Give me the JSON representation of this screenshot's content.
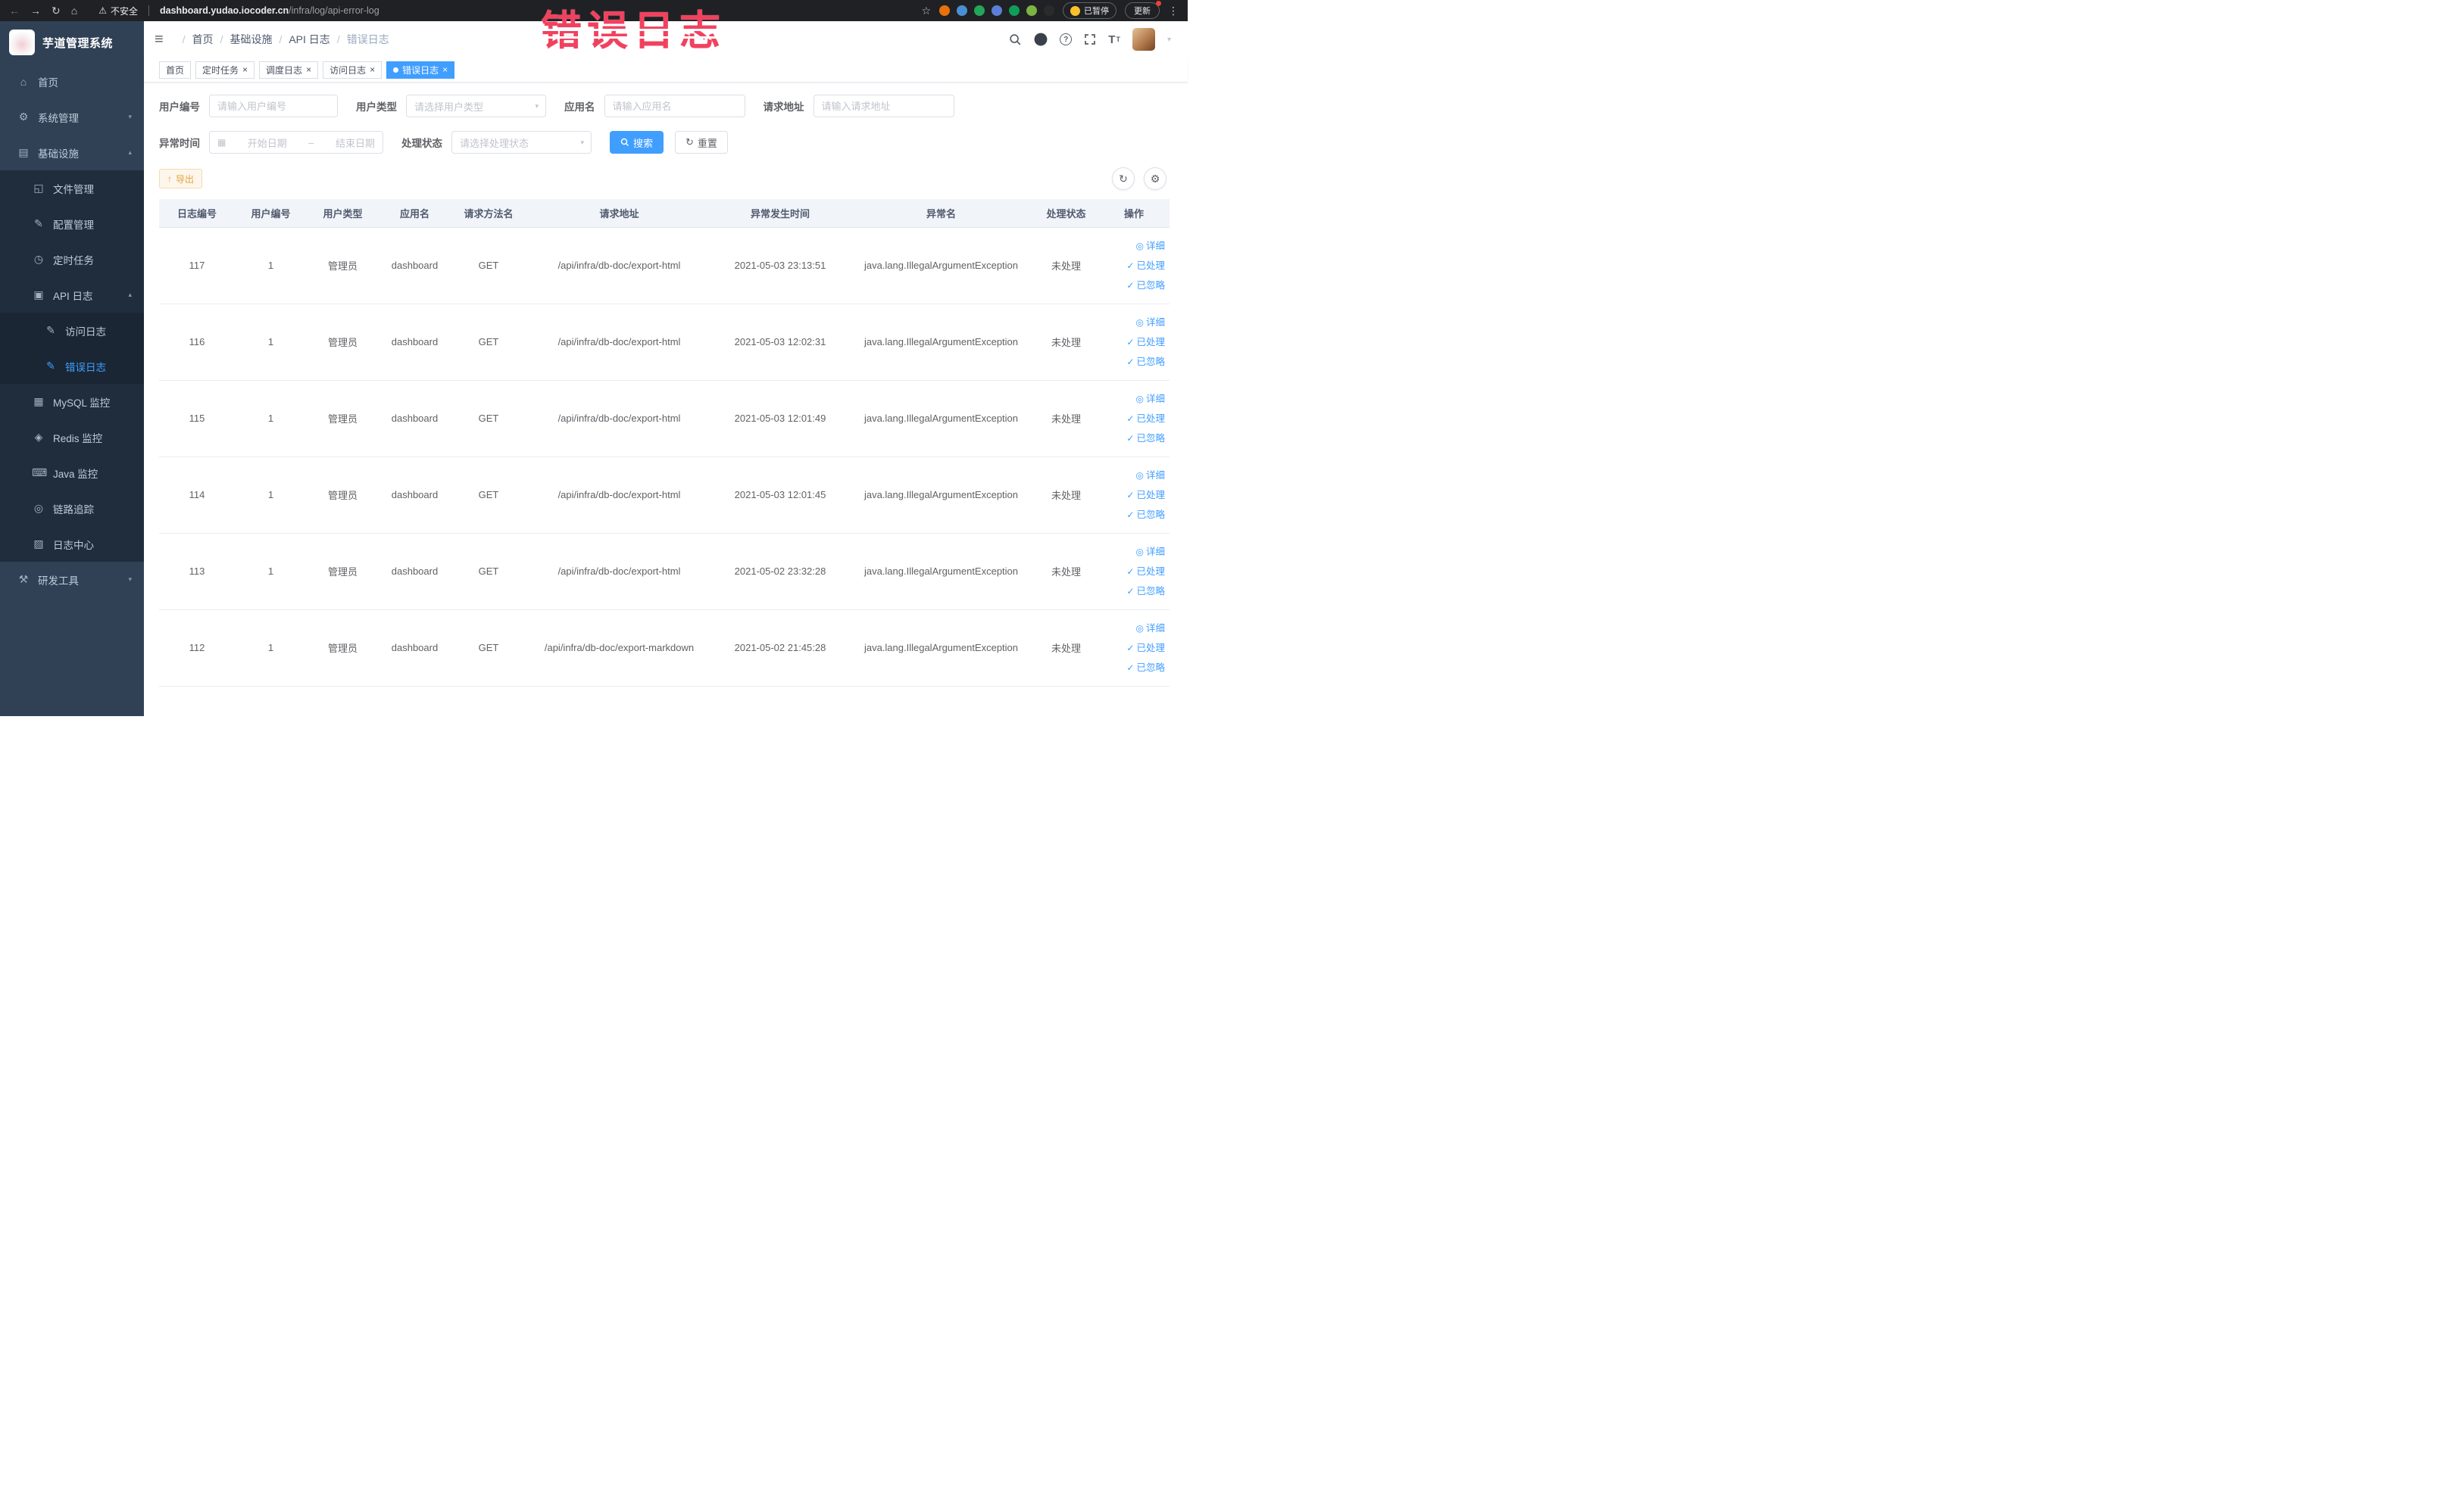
{
  "annotation": {
    "text": "错误日志"
  },
  "browser": {
    "security_warning": "不安全",
    "url_domain": "dashboard.yudao.iocoder.cn",
    "url_path": "/infra/log/api-error-log",
    "paused_badge": "已暂停",
    "update_button": "更新",
    "extensions": [
      {
        "name": "extension-red-circle-icon",
        "color": "#e8710a"
      },
      {
        "name": "extension-blue-drop-icon",
        "color": "#4a8fd4"
      },
      {
        "name": "extension-green-circle-icon",
        "color": "#23a55a"
      },
      {
        "name": "extension-blue-grid-icon",
        "color": "#5b7fd7"
      },
      {
        "name": "extension-on-badge-icon",
        "color": "#0f9d58"
      },
      {
        "name": "extension-leaf-icon",
        "color": "#7cb342"
      },
      {
        "name": "extension-paw-icon",
        "color": "#2b2b2b"
      }
    ]
  },
  "sidebar": {
    "app_title": "芋道管理系统",
    "menu": [
      {
        "name": "sidebar-item-home",
        "label": "首页",
        "icon": "home-icon",
        "level": 1
      },
      {
        "name": "sidebar-item-system",
        "label": "系统管理",
        "icon": "gear-icon",
        "level": 1,
        "arrow": "chevron-down-icon"
      },
      {
        "name": "sidebar-item-infra",
        "label": "基础设施",
        "icon": "infra-icon",
        "level": 1,
        "arrow": "chevron-up-icon",
        "open": true
      },
      {
        "name": "sidebar-item-file-manage",
        "label": "文件管理",
        "icon": "file-icon",
        "level": 2
      },
      {
        "name": "sidebar-item-config-manage",
        "label": "配置管理",
        "icon": "config-icon",
        "level": 2
      },
      {
        "name": "sidebar-item-scheduled-job",
        "label": "定时任务",
        "icon": "timer-icon",
        "level": 2
      },
      {
        "name": "sidebar-item-api-log",
        "label": "API 日志",
        "icon": "api-log-icon",
        "level": 2,
        "arrow": "chevron-up-icon",
        "open": true
      },
      {
        "name": "sidebar-item-access-log",
        "label": "访问日志",
        "icon": "access-log-icon",
        "level": 3
      },
      {
        "name": "sidebar-item-error-log",
        "label": "错误日志",
        "icon": "error-log-icon",
        "level": 3,
        "active": true
      },
      {
        "name": "sidebar-item-mysql-monitor",
        "label": "MySQL 监控",
        "icon": "mysql-icon",
        "level": 2
      },
      {
        "name": "sidebar-item-redis-monitor",
        "label": "Redis 监控",
        "icon": "redis-icon",
        "level": 2
      },
      {
        "name": "sidebar-item-java-monitor",
        "label": "Java 监控",
        "icon": "java-icon",
        "level": 2
      },
      {
        "name": "sidebar-item-trace",
        "label": "链路追踪",
        "icon": "trace-icon",
        "level": 2
      },
      {
        "name": "sidebar-item-log-center",
        "label": "日志中心",
        "icon": "log-center-icon",
        "level": 2
      },
      {
        "name": "sidebar-item-dev-tools",
        "label": "研发工具",
        "icon": "tools-icon",
        "level": 1,
        "arrow": "chevron-down-icon"
      }
    ]
  },
  "header": {
    "breadcrumb": [
      {
        "label": "首页",
        "clickable": "true"
      },
      {
        "label": "基础设施",
        "clickable": "false"
      },
      {
        "label": "API 日志",
        "clickable": "false"
      },
      {
        "label": "错误日志",
        "clickable": "false",
        "active": true
      }
    ],
    "icon_names": [
      "search-icon",
      "github-icon",
      "help-icon",
      "fullscreen-icon",
      "font-size-icon",
      "avatar",
      "chevron-down-icon"
    ]
  },
  "tabs": [
    {
      "name": "tab-home",
      "label": "首页"
    },
    {
      "name": "tab-scheduled-job",
      "label": "定时任务",
      "closable": true
    },
    {
      "name": "tab-job-log",
      "label": "调度日志",
      "closable": true
    },
    {
      "name": "tab-access-log",
      "label": "访问日志",
      "closable": true
    },
    {
      "name": "tab-error-log",
      "label": "错误日志",
      "closable": true,
      "active": true
    }
  ],
  "filters": {
    "user_id_label": "用户编号",
    "user_id_placeholder": "请输入用户编号",
    "user_type_label": "用户类型",
    "user_type_placeholder": "请选择用户类型",
    "app_name_label": "应用名",
    "app_name_placeholder": "请输入应用名",
    "request_url_label": "请求地址",
    "request_url_placeholder": "请输入请求地址",
    "exception_time_label": "异常时间",
    "start_date_placeholder": "开始日期",
    "date_separator": "–",
    "end_date_placeholder": "结束日期",
    "process_status_label": "处理状态",
    "process_status_placeholder": "请选择处理状态",
    "search_button": "搜索",
    "reset_button": "重置"
  },
  "toolbar": {
    "export_button": "导出"
  },
  "table": {
    "headers": [
      "日志编号",
      "用户编号",
      "用户类型",
      "应用名",
      "请求方法名",
      "请求地址",
      "异常发生时间",
      "异常名",
      "处理状态",
      "操作"
    ],
    "actions": [
      "详细",
      "已处理",
      "已忽略"
    ],
    "rows": [
      {
        "log_id": "117",
        "user_id": "1",
        "user_type": "管理员",
        "app_name": "dashboard",
        "method": "GET",
        "url": "/api/infra/db-doc/export-html",
        "time": "2021-05-03 23:13:51",
        "exception": "java.lang.IllegalArgumentException",
        "status": "未处理"
      },
      {
        "log_id": "116",
        "user_id": "1",
        "user_type": "管理员",
        "app_name": "dashboard",
        "method": "GET",
        "url": "/api/infra/db-doc/export-html",
        "time": "2021-05-03 12:02:31",
        "exception": "java.lang.IllegalArgumentException",
        "status": "未处理"
      },
      {
        "log_id": "115",
        "user_id": "1",
        "user_type": "管理员",
        "app_name": "dashboard",
        "method": "GET",
        "url": "/api/infra/db-doc/export-html",
        "time": "2021-05-03 12:01:49",
        "exception": "java.lang.IllegalArgumentException",
        "status": "未处理"
      },
      {
        "log_id": "114",
        "user_id": "1",
        "user_type": "管理员",
        "app_name": "dashboard",
        "method": "GET",
        "url": "/api/infra/db-doc/export-html",
        "time": "2021-05-03 12:01:45",
        "exception": "java.lang.IllegalArgumentException",
        "status": "未处理"
      },
      {
        "log_id": "113",
        "user_id": "1",
        "user_type": "管理员",
        "app_name": "dashboard",
        "method": "GET",
        "url": "/api/infra/db-doc/export-html",
        "time": "2021-05-02 23:32:28",
        "exception": "java.lang.IllegalArgumentException",
        "status": "未处理"
      },
      {
        "log_id": "112",
        "user_id": "1",
        "user_type": "管理员",
        "app_name": "dashboard",
        "method": "GET",
        "url": "/api/infra/db-doc/export-markdown",
        "time": "2021-05-02 21:45:28",
        "exception": "java.lang.IllegalArgumentException",
        "status": "未处理"
      }
    ]
  }
}
